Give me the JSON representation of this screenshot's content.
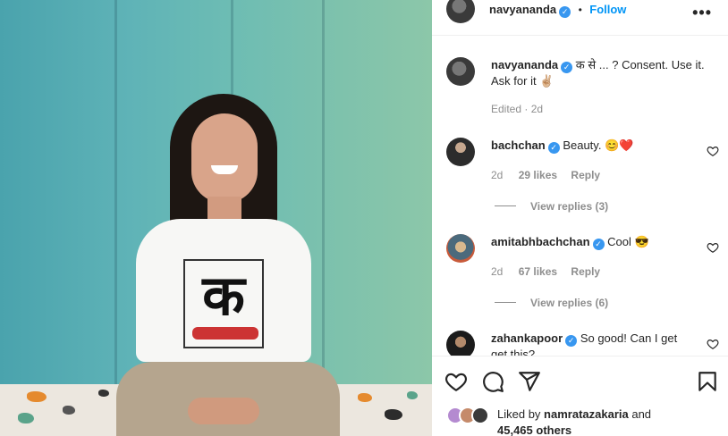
{
  "header": {
    "username": "navyananda",
    "separator": "•",
    "follow_label": "Follow",
    "more_icon": "more-options-icon"
  },
  "caption": {
    "username": "navyananda",
    "text_line1": "क से ... ? Consent. Use it.",
    "text_line2": "Ask for it ✌🏼",
    "meta": "Edited · 2d"
  },
  "comments": [
    {
      "username": "bachchan",
      "text": "Beauty. 😊❤️",
      "age": "2d",
      "likes": "29 likes",
      "reply_label": "Reply",
      "view_replies": "View replies (3)"
    },
    {
      "username": "amitabhbachchan",
      "text": "Cool 😎",
      "age": "2d",
      "likes": "67 likes",
      "reply_label": "Reply",
      "view_replies": "View replies (6)"
    },
    {
      "username": "zahankapoor",
      "text_line1": "So good! Can I get",
      "text_line2": "get this?"
    }
  ],
  "likes": {
    "prefix": "Liked by",
    "user": "namratazakaria",
    "joiner": "and",
    "others": "45,465 others"
  },
  "post_image": {
    "shirt_glyph": "क"
  },
  "colors": {
    "link": "#0095f6",
    "verified": "#3897f0",
    "muted": "#8e8e8e",
    "text": "#262626"
  }
}
